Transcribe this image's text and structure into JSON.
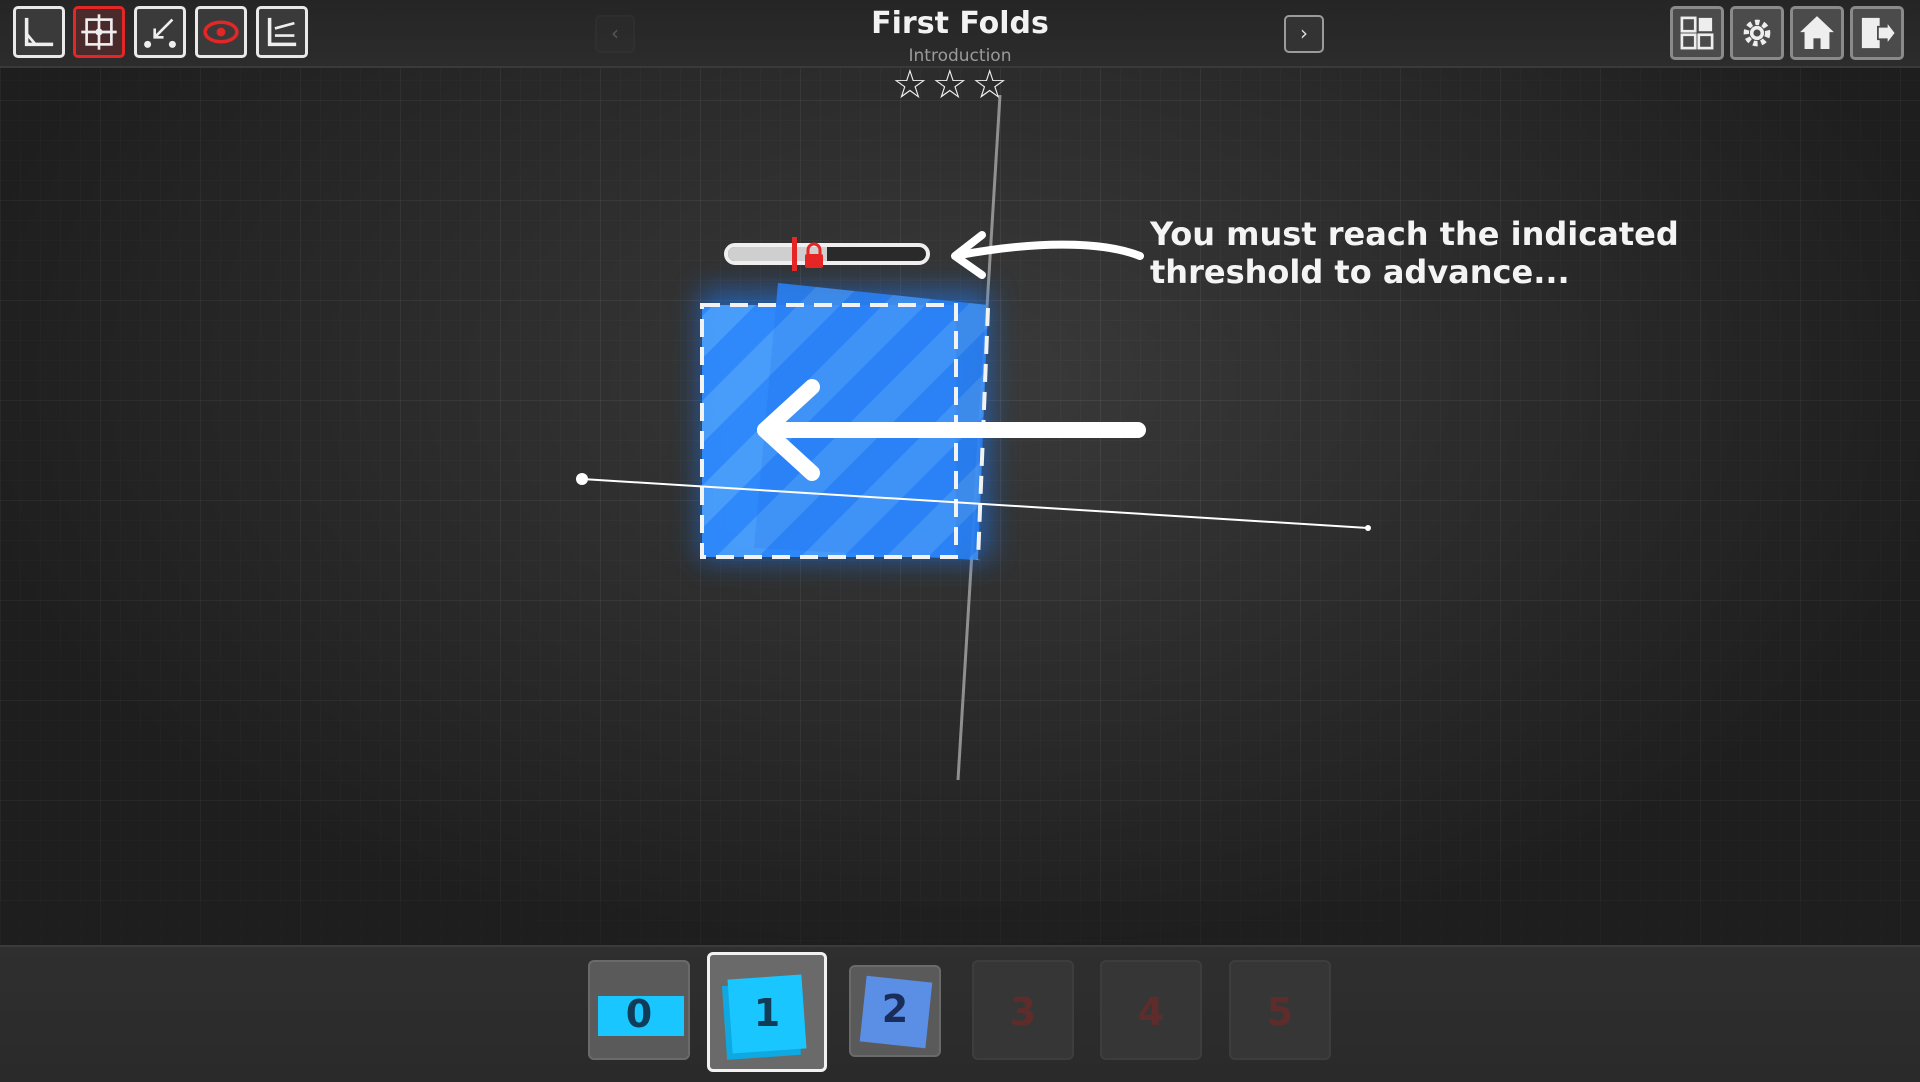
{
  "header": {
    "title": "First Folds",
    "subtitle": "Introduction",
    "stars": [
      "☆",
      "☆",
      "☆"
    ],
    "prev_label": "‹",
    "next_label": "›"
  },
  "toolbar": {
    "tools": [
      {
        "name": "fold-tool",
        "icon": "corner-fold-icon",
        "active": false
      },
      {
        "name": "move-tool",
        "icon": "move-crosshair-icon",
        "active": true
      },
      {
        "name": "point-tool",
        "icon": "point-arrow-icon",
        "active": false
      },
      {
        "name": "view-tool",
        "icon": "eye-icon",
        "active": false
      },
      {
        "name": "stack-tool",
        "icon": "stack-fold-icon",
        "active": false
      }
    ],
    "system": [
      "layout-icon",
      "gear-icon",
      "home-icon",
      "exit-icon"
    ]
  },
  "hint": {
    "text": "You must reach the indicated\nthreshold to advance..."
  },
  "progress": {
    "fill_fraction": 0.5,
    "threshold_fraction": 0.4
  },
  "levels": [
    {
      "label": "0",
      "state": "complete"
    },
    {
      "label": "1",
      "state": "selected"
    },
    {
      "label": "2",
      "state": "unlocked"
    },
    {
      "label": "3",
      "state": "locked"
    },
    {
      "label": "4",
      "state": "locked"
    },
    {
      "label": "5",
      "state": "locked"
    }
  ],
  "colors": {
    "paper_blue": "#1e88ff",
    "highlight_red": "#e32626",
    "slot_cyan": "#19c6ff"
  }
}
